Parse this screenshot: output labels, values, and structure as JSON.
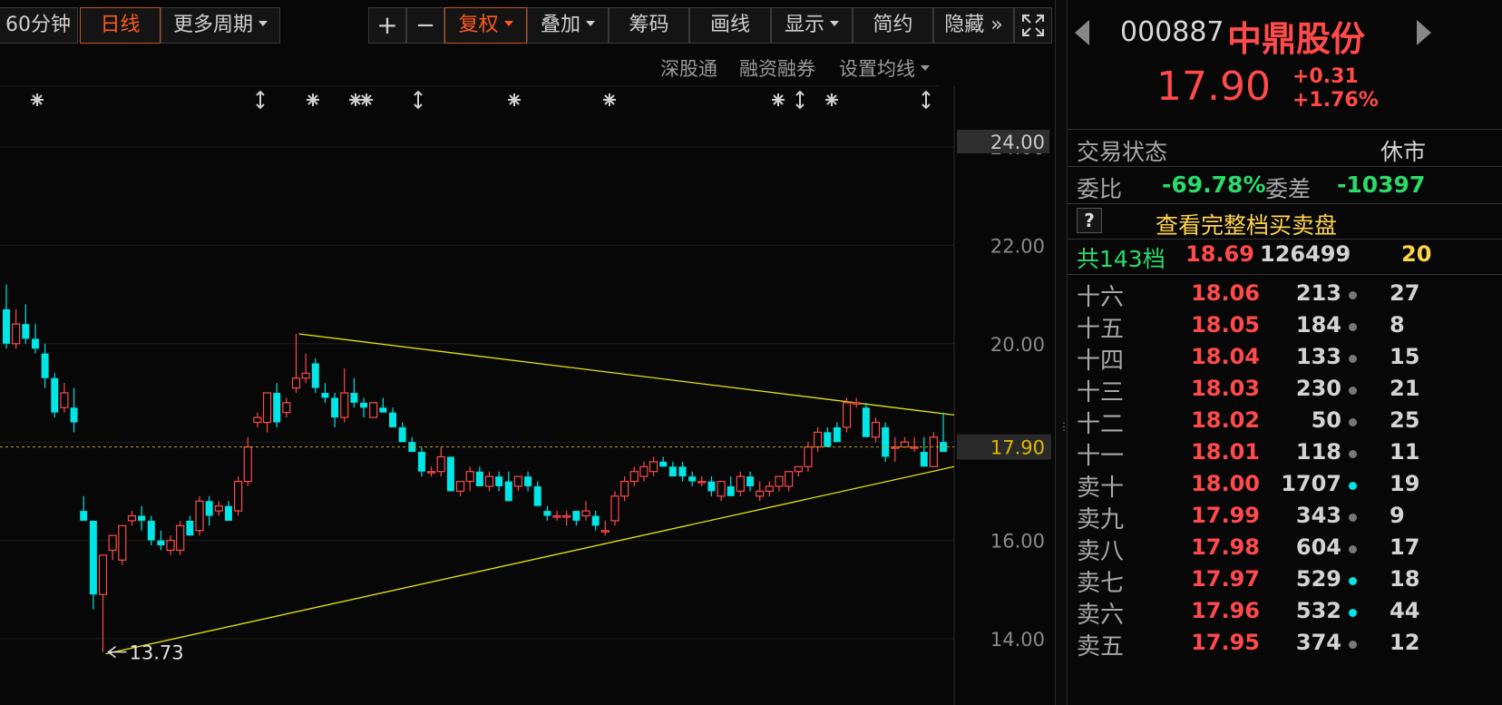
{
  "toolbar": {
    "min60": "60分钟",
    "daily": "日线",
    "more_periods": "更多周期",
    "zoom_in": "+",
    "zoom_out": "−",
    "fuquan": "复权",
    "overlay": "叠加",
    "chips": "筹码",
    "draw": "画线",
    "display": "显示",
    "simple": "简约",
    "hide": "隐藏",
    "hide_arrows": "»"
  },
  "sublinks": {
    "shenzhen_connect": "深股通",
    "margin": "融资融券",
    "ma_settings": "设置均线"
  },
  "chart_data": {
    "type": "candlestick",
    "ylim": [
      13.3,
      24.4
    ],
    "y_ticks": [
      24.0,
      22.0,
      20.0,
      18.0,
      16.0,
      14.0
    ],
    "y_tick_labels": [
      "24.00",
      "22.00",
      "20.00",
      "",
      "16.00",
      "14.00"
    ],
    "top_price_tag": "24.00",
    "current_price": 17.9,
    "current_price_label": "17.90",
    "low_marker": {
      "value": 13.73,
      "label": "13.73"
    },
    "candles": [
      [
        20.7,
        21.2,
        19.9,
        20.0
      ],
      [
        20.0,
        20.7,
        19.9,
        20.4
      ],
      [
        20.4,
        20.8,
        20.0,
        20.1
      ],
      [
        20.1,
        20.4,
        19.8,
        19.9
      ],
      [
        19.8,
        20.0,
        19.1,
        19.3
      ],
      [
        19.3,
        19.4,
        18.5,
        18.6
      ],
      [
        18.7,
        19.2,
        18.6,
        19.0
      ],
      [
        18.7,
        19.1,
        18.2,
        18.4
      ],
      [
        16.6,
        16.9,
        16.4,
        16.4
      ],
      [
        16.4,
        16.4,
        14.6,
        14.9
      ],
      [
        14.9,
        15.7,
        13.73,
        15.7
      ],
      [
        15.8,
        16.1,
        15.6,
        16.1
      ],
      [
        15.6,
        16.3,
        15.5,
        16.3
      ],
      [
        16.4,
        16.6,
        16.3,
        16.5
      ],
      [
        16.5,
        16.7,
        16.2,
        16.4
      ],
      [
        16.4,
        16.5,
        15.9,
        16.0
      ],
      [
        16.0,
        16.2,
        15.8,
        15.9
      ],
      [
        15.8,
        16.1,
        15.7,
        16.0
      ],
      [
        15.8,
        16.4,
        15.7,
        16.3
      ],
      [
        16.4,
        16.5,
        16.1,
        16.1
      ],
      [
        16.2,
        16.9,
        16.1,
        16.8
      ],
      [
        16.8,
        16.9,
        16.3,
        16.5
      ],
      [
        16.6,
        16.8,
        16.5,
        16.7
      ],
      [
        16.7,
        16.8,
        16.4,
        16.4
      ],
      [
        16.6,
        17.3,
        16.5,
        17.2
      ],
      [
        17.2,
        18.1,
        17.1,
        17.9
      ],
      [
        18.4,
        18.6,
        18.3,
        18.5
      ],
      [
        18.4,
        18.9,
        18.2,
        19.0
      ],
      [
        19.0,
        19.2,
        18.3,
        18.4
      ],
      [
        18.6,
        18.9,
        18.5,
        18.8
      ],
      [
        19.1,
        20.2,
        19.0,
        19.3
      ],
      [
        19.3,
        19.8,
        19.2,
        19.4
      ],
      [
        19.6,
        19.7,
        19.0,
        19.1
      ],
      [
        19.0,
        19.2,
        18.8,
        18.9
      ],
      [
        18.9,
        19.0,
        18.3,
        18.5
      ],
      [
        18.5,
        19.5,
        18.4,
        19.0
      ],
      [
        19.0,
        19.3,
        18.7,
        18.8
      ],
      [
        18.8,
        18.9,
        18.5,
        18.7
      ],
      [
        18.5,
        18.8,
        18.5,
        18.8
      ],
      [
        18.7,
        18.9,
        18.6,
        18.6
      ],
      [
        18.6,
        18.7,
        18.3,
        18.3
      ],
      [
        18.3,
        18.4,
        18.0,
        18.0
      ],
      [
        18.0,
        18.1,
        17.8,
        17.8
      ],
      [
        17.8,
        17.9,
        17.3,
        17.4
      ],
      [
        17.4,
        17.5,
        17.3,
        17.4
      ],
      [
        17.4,
        17.9,
        17.3,
        17.7
      ],
      [
        17.7,
        17.7,
        17.1,
        17.0
      ],
      [
        17.0,
        17.2,
        16.9,
        17.2
      ],
      [
        17.2,
        17.5,
        17.0,
        17.4
      ],
      [
        17.4,
        17.5,
        17.1,
        17.1
      ],
      [
        17.1,
        17.4,
        17.0,
        17.3
      ],
      [
        17.3,
        17.4,
        17.0,
        17.1
      ],
      [
        17.2,
        17.4,
        16.8,
        16.8
      ],
      [
        17.1,
        17.3,
        17.0,
        17.3
      ],
      [
        17.3,
        17.4,
        17.0,
        17.1
      ],
      [
        17.1,
        17.2,
        16.7,
        16.7
      ],
      [
        16.6,
        16.7,
        16.4,
        16.5
      ],
      [
        16.5,
        16.6,
        16.4,
        16.5
      ],
      [
        16.5,
        16.6,
        16.3,
        16.5
      ],
      [
        16.6,
        16.6,
        16.3,
        16.4
      ],
      [
        16.5,
        16.8,
        16.4,
        16.6
      ],
      [
        16.5,
        16.6,
        16.2,
        16.3
      ],
      [
        16.2,
        16.4,
        16.1,
        16.2
      ],
      [
        16.4,
        17.0,
        16.3,
        16.9
      ],
      [
        16.9,
        17.3,
        16.8,
        17.2
      ],
      [
        17.2,
        17.5,
        17.1,
        17.4
      ],
      [
        17.3,
        17.6,
        17.2,
        17.5
      ],
      [
        17.4,
        17.7,
        17.3,
        17.6
      ],
      [
        17.6,
        17.7,
        17.5,
        17.5
      ],
      [
        17.5,
        17.6,
        17.3,
        17.3
      ],
      [
        17.5,
        17.6,
        17.2,
        17.3
      ],
      [
        17.3,
        17.4,
        17.1,
        17.2
      ],
      [
        17.2,
        17.3,
        17.1,
        17.2
      ],
      [
        17.2,
        17.3,
        16.9,
        17.0
      ],
      [
        16.9,
        17.2,
        16.8,
        17.2
      ],
      [
        17.1,
        17.3,
        16.9,
        16.9
      ],
      [
        17.0,
        17.4,
        16.9,
        17.3
      ],
      [
        17.3,
        17.4,
        17.0,
        17.1
      ],
      [
        16.9,
        17.2,
        16.8,
        17.0
      ],
      [
        17.0,
        17.2,
        16.9,
        17.1
      ],
      [
        17.1,
        17.3,
        17.0,
        17.3
      ],
      [
        17.1,
        17.4,
        17.0,
        17.4
      ],
      [
        17.4,
        17.5,
        17.3,
        17.5
      ],
      [
        17.5,
        18.0,
        17.4,
        17.9
      ],
      [
        17.9,
        18.3,
        17.8,
        18.2
      ],
      [
        18.2,
        18.3,
        17.9,
        17.9
      ],
      [
        18.3,
        18.4,
        18.1,
        18.0
      ],
      [
        18.3,
        18.9,
        18.2,
        18.8
      ],
      [
        18.8,
        18.9,
        18.7,
        18.8
      ],
      [
        18.7,
        18.8,
        18.1,
        18.1
      ],
      [
        18.1,
        18.5,
        18.0,
        18.4
      ],
      [
        18.3,
        18.4,
        17.6,
        17.7
      ],
      [
        17.9,
        18.1,
        17.6,
        17.9
      ],
      [
        17.9,
        18.1,
        17.9,
        18.0
      ],
      [
        17.9,
        18.1,
        17.8,
        17.9
      ],
      [
        17.8,
        18.1,
        17.6,
        17.5
      ],
      [
        17.5,
        18.2,
        17.5,
        18.1
      ],
      [
        18.0,
        18.6,
        17.8,
        17.8
      ]
    ],
    "trendlines": [
      {
        "from": [
          13.73,
          0
        ],
        "to": [
          17.5,
          1
        ],
        "color": "#e6e600"
      },
      {
        "from": [
          20.2,
          0
        ],
        "to": [
          18.55,
          1
        ],
        "color": "#e6e600"
      }
    ],
    "colors": {
      "up": "#ff4a4a",
      "down": "#00e5e5",
      "price_tag_bg": "#2e2e2e"
    }
  },
  "quote": {
    "code": "000887",
    "name": "中鼎股份",
    "price": "17.90",
    "change": "+0.31",
    "change_pct": "+1.76%",
    "status_label": "交易状态",
    "status_value": "休市",
    "weibi_label": "委比",
    "weibi_value": "-69.78%",
    "weicha_label": "委差",
    "weicha_value": "-10397",
    "full_book": "查看完整档买卖盘",
    "help": "?",
    "total_levels": "共143档",
    "total_price": "18.69",
    "total_vol": "126499",
    "total_extra": "20",
    "rows": [
      {
        "name": "十六",
        "price": "18.06",
        "vol": "213",
        "dot": "gray",
        "extra": "27"
      },
      {
        "name": "十五",
        "price": "18.05",
        "vol": "184",
        "dot": "gray",
        "extra": "8"
      },
      {
        "name": "十四",
        "price": "18.04",
        "vol": "133",
        "dot": "gray",
        "extra": "15"
      },
      {
        "name": "十三",
        "price": "18.03",
        "vol": "230",
        "dot": "gray",
        "extra": "21"
      },
      {
        "name": "十二",
        "price": "18.02",
        "vol": "50",
        "dot": "gray",
        "extra": "25"
      },
      {
        "name": "十一",
        "price": "18.01",
        "vol": "118",
        "dot": "gray",
        "extra": "11"
      },
      {
        "name": "卖十",
        "price": "18.00",
        "vol": "1707",
        "dot": "cyan",
        "extra": "19"
      },
      {
        "name": "卖九",
        "price": "17.99",
        "vol": "343",
        "dot": "gray",
        "extra": "9"
      },
      {
        "name": "卖八",
        "price": "17.98",
        "vol": "604",
        "dot": "gray",
        "extra": "17"
      },
      {
        "name": "卖七",
        "price": "17.97",
        "vol": "529",
        "dot": "cyan",
        "extra": "18"
      },
      {
        "name": "卖六",
        "price": "17.96",
        "vol": "532",
        "dot": "cyan",
        "extra": "44"
      },
      {
        "name": "卖五",
        "price": "17.95",
        "vol": "374",
        "dot": "gray",
        "extra": "12"
      }
    ]
  }
}
